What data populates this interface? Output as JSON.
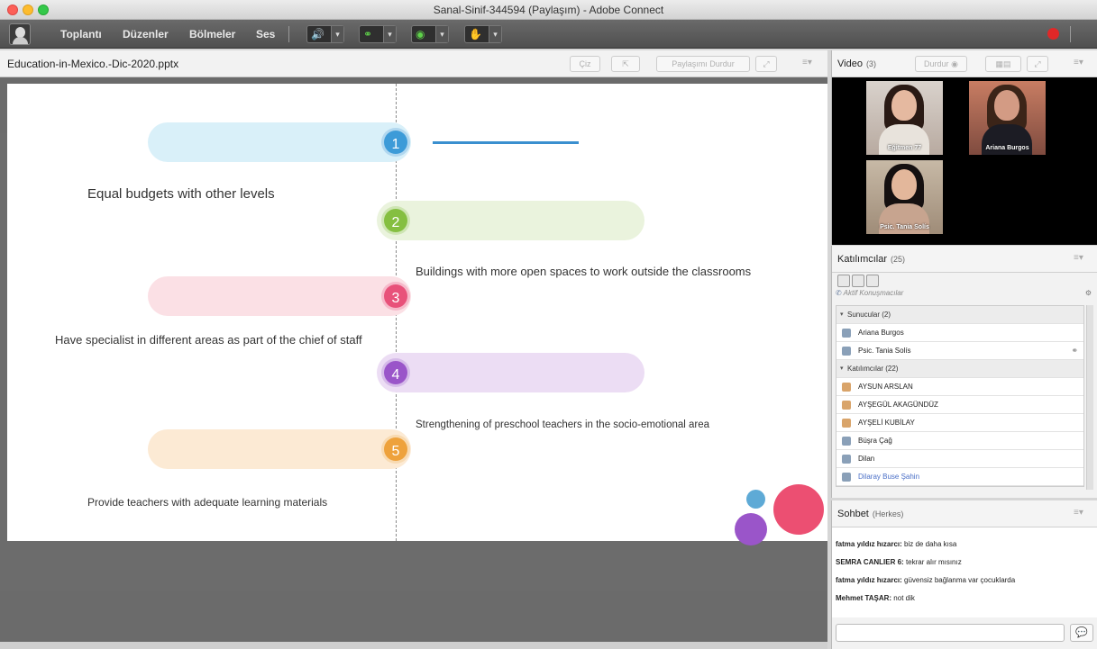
{
  "window": {
    "title": "Sanal-Sinif-344594 (Paylaşım) - Adobe Connect"
  },
  "menubar": {
    "items": [
      "Toplantı",
      "Düzenler",
      "Bölmeler",
      "Ses"
    ],
    "tools": [
      "speaker-icon",
      "mic-icon",
      "webcam-icon",
      "raise-hand-icon"
    ],
    "record_color": "#e02828"
  },
  "share": {
    "title": "Education-in-Mexico.-Dic-2020.pptx",
    "draw_label": "Çiz",
    "stop_label": "Paylaşımı Durdur"
  },
  "slide": {
    "items": [
      {
        "number": "1",
        "text": "",
        "color": "#3d9bd8",
        "pill": "#d9f0f9"
      },
      {
        "number": "2",
        "text": "Equal budgets with other levels",
        "color": "#85bf41",
        "pill": "#eaf3dd"
      },
      {
        "number": "3",
        "text": "Buildings with more open spaces to work outside the classrooms",
        "color": "#e8517a",
        "pill": "#fbe0e5"
      },
      {
        "number": "4",
        "text": "Have specialist in different areas as part of the chief of staff",
        "color": "#9a55c9",
        "pill": "#ecddf4"
      },
      {
        "number": "5",
        "text": "Strengthening of preschool teachers in the socio-emotional area",
        "color": "#eea23c",
        "pill": "#fcead4"
      },
      {
        "number": "",
        "text": "Provide teachers with adequate learning  materials",
        "color": "",
        "pill": ""
      }
    ]
  },
  "video": {
    "title": "Video",
    "count": "(3)",
    "stop_label": "Durdur",
    "participants": [
      "Eğitmen 77",
      "Ariana Burgos",
      "Psic. Tania Solís"
    ]
  },
  "attendees": {
    "title": "Katılımcılar",
    "count": "(25)",
    "search_placeholder": "Aktif Konuşmacılar",
    "presenters_group": "Sunucular (2)",
    "presenters": [
      "Ariana Burgos",
      "Psic. Tania Solís"
    ],
    "participants_group": "Katılımcılar (22)",
    "participants": [
      "AYSUN ARSLAN",
      "AYŞEGÜL AKAGÜNDÜZ",
      "AYŞELİ KUBİLAY",
      "Büşra Çağ",
      "Dilan",
      "Dilaray Buse Şahin"
    ]
  },
  "chat": {
    "title": "Sohbet",
    "scope": "(Herkes)",
    "messages": [
      {
        "sender": "fatma yıldız hızarcı:",
        "text": " biz de daha kısa"
      },
      {
        "sender": "SEMRA CANLIER 6:",
        "text": " tekrar alır mısınız"
      },
      {
        "sender": "fatma yıldız hızarcı:",
        "text": " güvensiz bağlanma var çocuklarda"
      },
      {
        "sender": "Mehmet TAŞAR:",
        "text": " not dik"
      }
    ]
  }
}
